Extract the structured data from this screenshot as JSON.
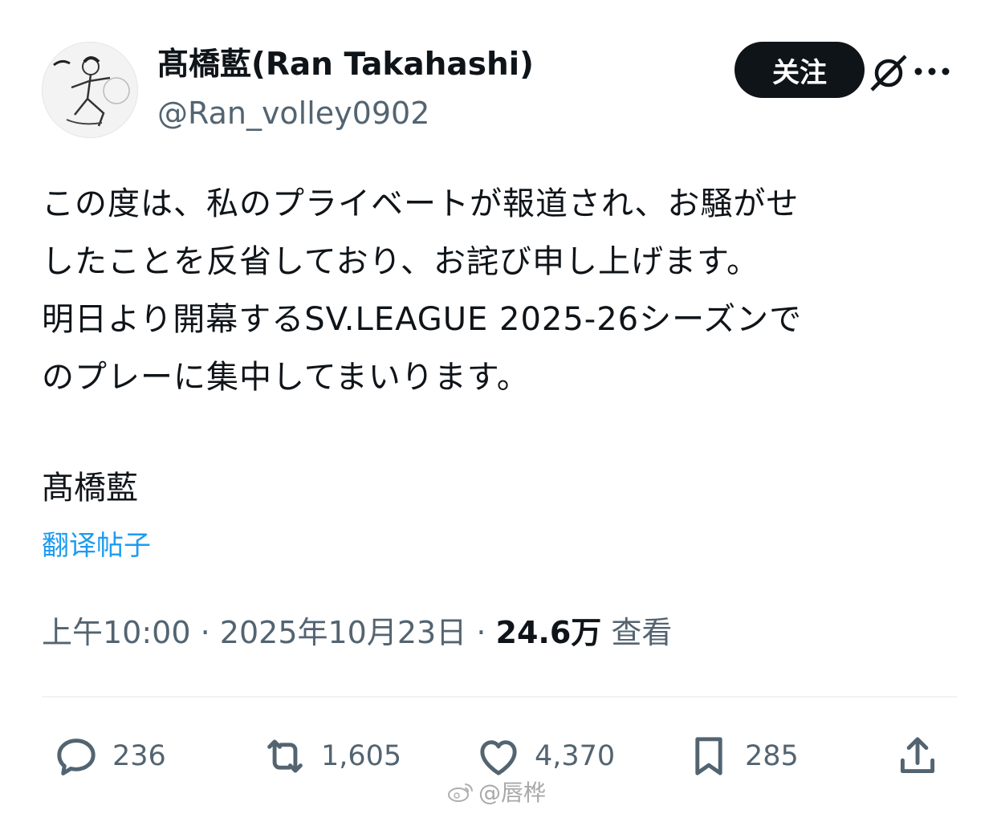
{
  "user": {
    "display_name": "髙橋藍(Ran Takahashi)",
    "handle": "@Ran_volley0902",
    "avatar_icon": "volleyball-player-sketch-avatar"
  },
  "header": {
    "follow_label": "关注",
    "grok_icon": "grok-icon",
    "more_icon": "more-icon"
  },
  "tweet": {
    "lines": [
      "この度は、私のプライベートが報道され、お騒がせ",
      "したことを反省しており、お詫び申し上げます。",
      "明日より開幕するSV.LEAGUE 2025-26シーズンで",
      "のプレーに集中してまいります。"
    ],
    "signature": "髙橋藍",
    "translate_label": "翻译帖子"
  },
  "meta": {
    "time": "上午10:00",
    "separator": "·",
    "date": "2025年10月23日",
    "views_count": "24.6万",
    "views_label": "查看"
  },
  "actions": {
    "replies": "236",
    "reposts": "1,605",
    "likes": "4,370",
    "bookmarks": "285"
  },
  "watermark": {
    "text": "@唇桦",
    "icon": "weibo-icon"
  },
  "colors": {
    "text": "#0f1419",
    "secondary": "#536471",
    "link": "#1d9bf0",
    "button_bg": "#0f1419"
  }
}
